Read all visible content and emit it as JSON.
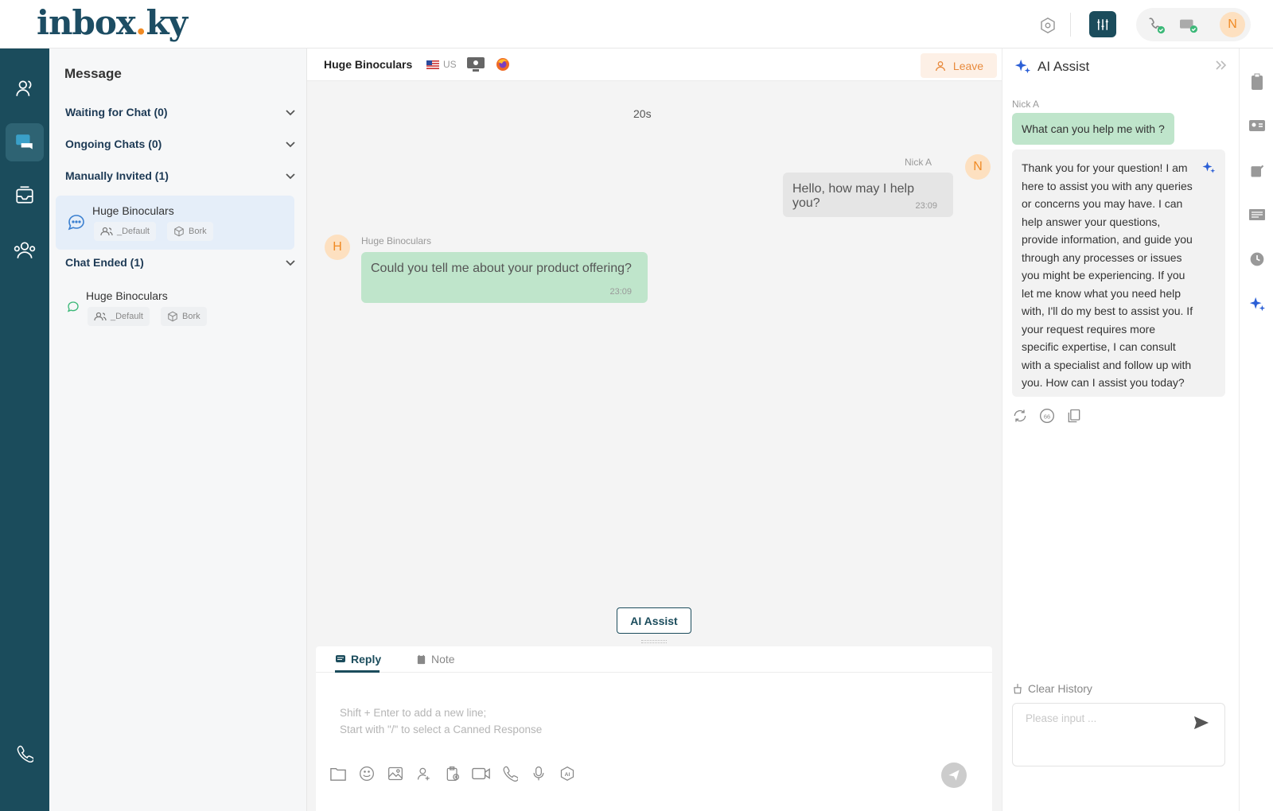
{
  "app": {
    "logo_main": "inbox",
    "logo_dot": ".",
    "logo_end": "ky"
  },
  "header": {
    "user_initial": "N"
  },
  "list": {
    "title": "Message",
    "sections": [
      {
        "label": "Waiting for Chat (0)"
      },
      {
        "label": "Ongoing Chats (0)"
      },
      {
        "label": "Manually Invited (1)"
      },
      {
        "label": "Chat Ended (1)"
      }
    ],
    "invited_item": {
      "name": "Huge Binoculars",
      "tag1": "_Default",
      "tag2": "Bork"
    },
    "ended_item": {
      "name": "Huge Binoculars",
      "tag1": "_Default",
      "tag2": "Bork"
    }
  },
  "chat": {
    "visitor_name": "Huge Binoculars",
    "country": "US",
    "leave_label": "Leave",
    "elapsed": "20s",
    "agent_name": "Nick A",
    "agent_initial": "N",
    "agent_message": "Hello, how may I help you?",
    "agent_time": "23:09",
    "visitor_label": "Huge Binoculars",
    "visitor_initial": "H",
    "visitor_message": "Could you tell me about your product offering?",
    "visitor_time": "23:09",
    "ai_assist_button": "AI Assist"
  },
  "composer": {
    "tab_reply": "Reply",
    "tab_note": "Note",
    "placeholder_line1": "Shift + Enter to add a new line;",
    "placeholder_line2": "Start with \"/\" to select a Canned Response"
  },
  "ai_panel": {
    "title": "AI Assist",
    "user_label": "Nick A",
    "question": "What can you help me with ?",
    "answer": "Thank you for your question! I am here to assist you with any queries or concerns you may have. I can help answer your questions, provide information, and guide you through any processes or issues you might be experiencing. If you let me know what you need help with, I'll do my best to assist you. If your request requires more specific expertise, I can consult with a specialist and follow up with you. How can I assist you today?",
    "clear_history": "Clear History",
    "input_placeholder": "Please input ..."
  },
  "colors": {
    "nav_bg": "#1b4c5c",
    "accent": "#1b4c5c",
    "orange": "#f08a24",
    "green_bubble": "#bfe5cb"
  }
}
